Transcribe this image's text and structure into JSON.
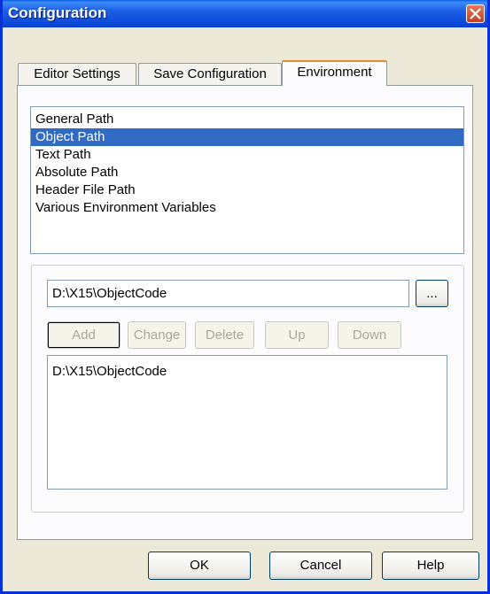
{
  "window": {
    "title": "Configuration"
  },
  "tabs": [
    {
      "label": "Editor Settings"
    },
    {
      "label": "Save Configuration"
    },
    {
      "label": "Environment"
    }
  ],
  "environment": {
    "categories": [
      "General Path",
      "Object Path",
      "Text Path",
      "Absolute Path",
      "Header File Path",
      "Various Environment Variables"
    ],
    "selected_index": 1,
    "path_value": "D:\\X15\\ObjectCode",
    "browse_label": "...",
    "buttons": {
      "add": "Add",
      "change": "Change",
      "delete": "Delete",
      "up": "Up",
      "down": "Down"
    },
    "paths": [
      "D:\\X15\\ObjectCode"
    ]
  },
  "footer": {
    "ok": "OK",
    "cancel": "Cancel",
    "help": "Help"
  },
  "colors": {
    "selection": "#316ac5",
    "titlebar": "#0a4ad8",
    "close": "#c83e1e"
  }
}
